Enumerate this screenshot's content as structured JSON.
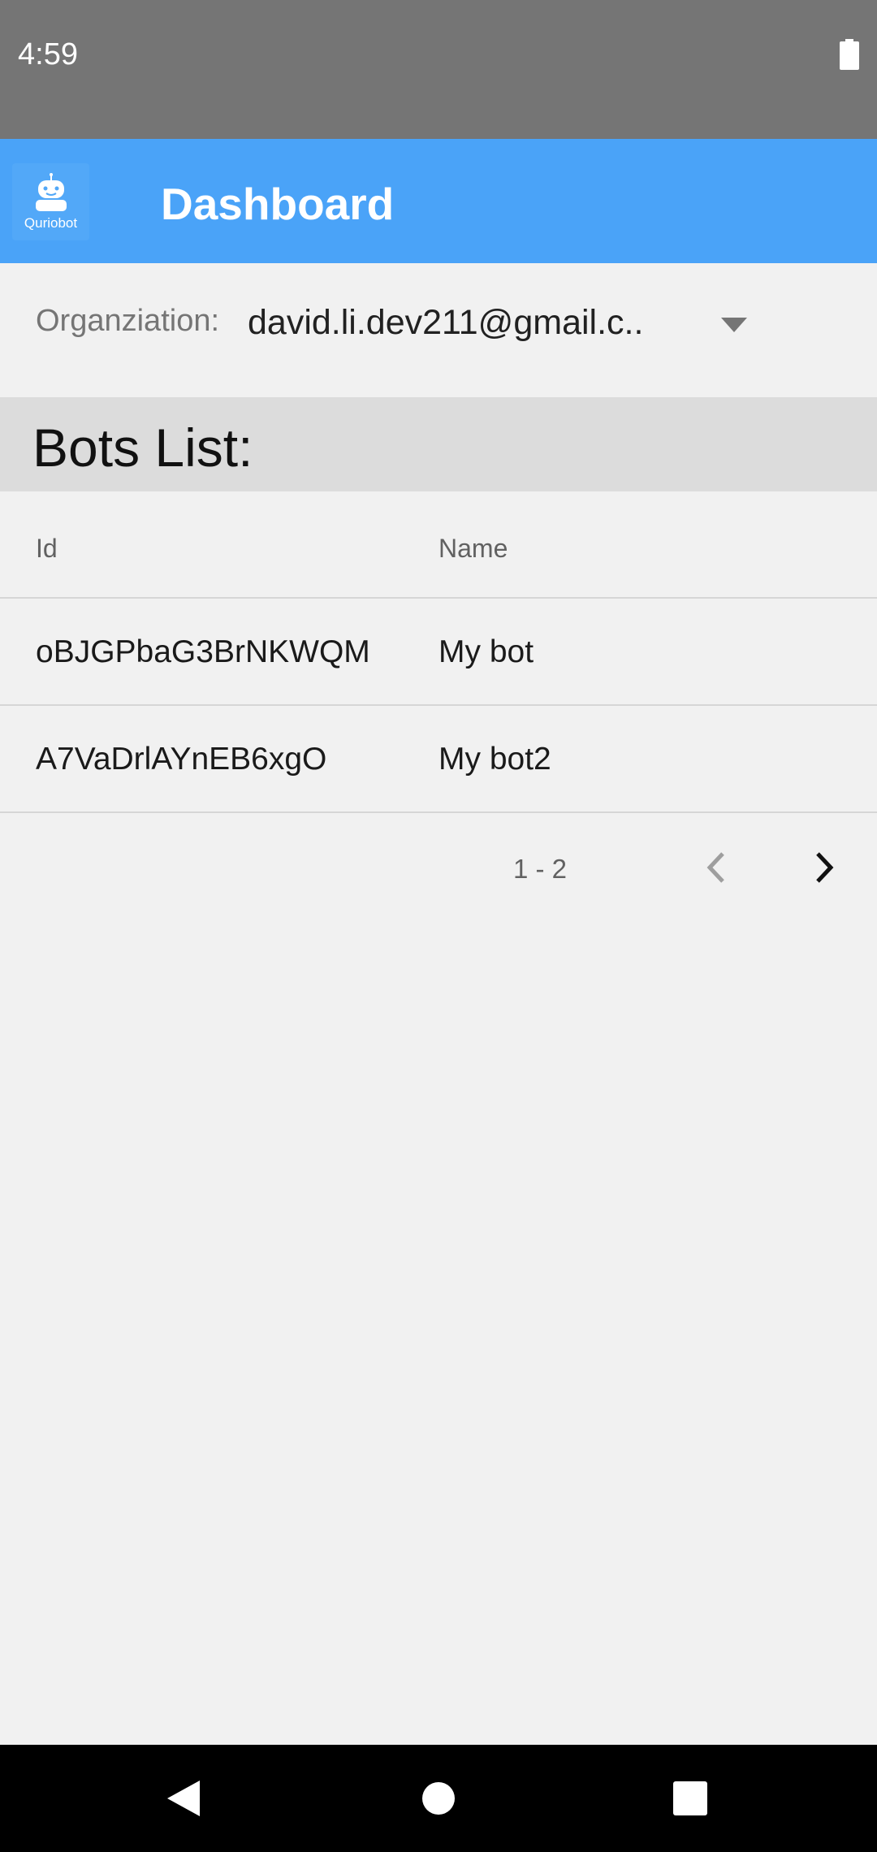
{
  "status_bar": {
    "time": "4:59",
    "battery_icon": "battery-full-icon"
  },
  "app_bar": {
    "logo_text": "Quriobot",
    "logo_icon": "robot-icon",
    "title": "Dashboard",
    "background_color": "#4aa3f8"
  },
  "organization": {
    "label": "Organziation:",
    "selected_value": "david.li.dev211@gmail.c..",
    "dropdown_icon": "arrow-drop-down-icon"
  },
  "bots_section": {
    "title": "Bots List:"
  },
  "table": {
    "columns": [
      "Id",
      "Name"
    ],
    "rows": [
      {
        "id": "oBJGPbaG3BrNKWQM",
        "name": "My bot"
      },
      {
        "id": "A7VaDrlAYnEB6xgO",
        "name": "My bot2"
      }
    ]
  },
  "pagination": {
    "range_text": "1 - 2",
    "prev_icon": "chevron-left-icon",
    "next_icon": "chevron-right-icon"
  },
  "nav_bar": {
    "back_icon": "back-triangle-icon",
    "home_icon": "home-circle-icon",
    "recents_icon": "recents-square-icon"
  }
}
